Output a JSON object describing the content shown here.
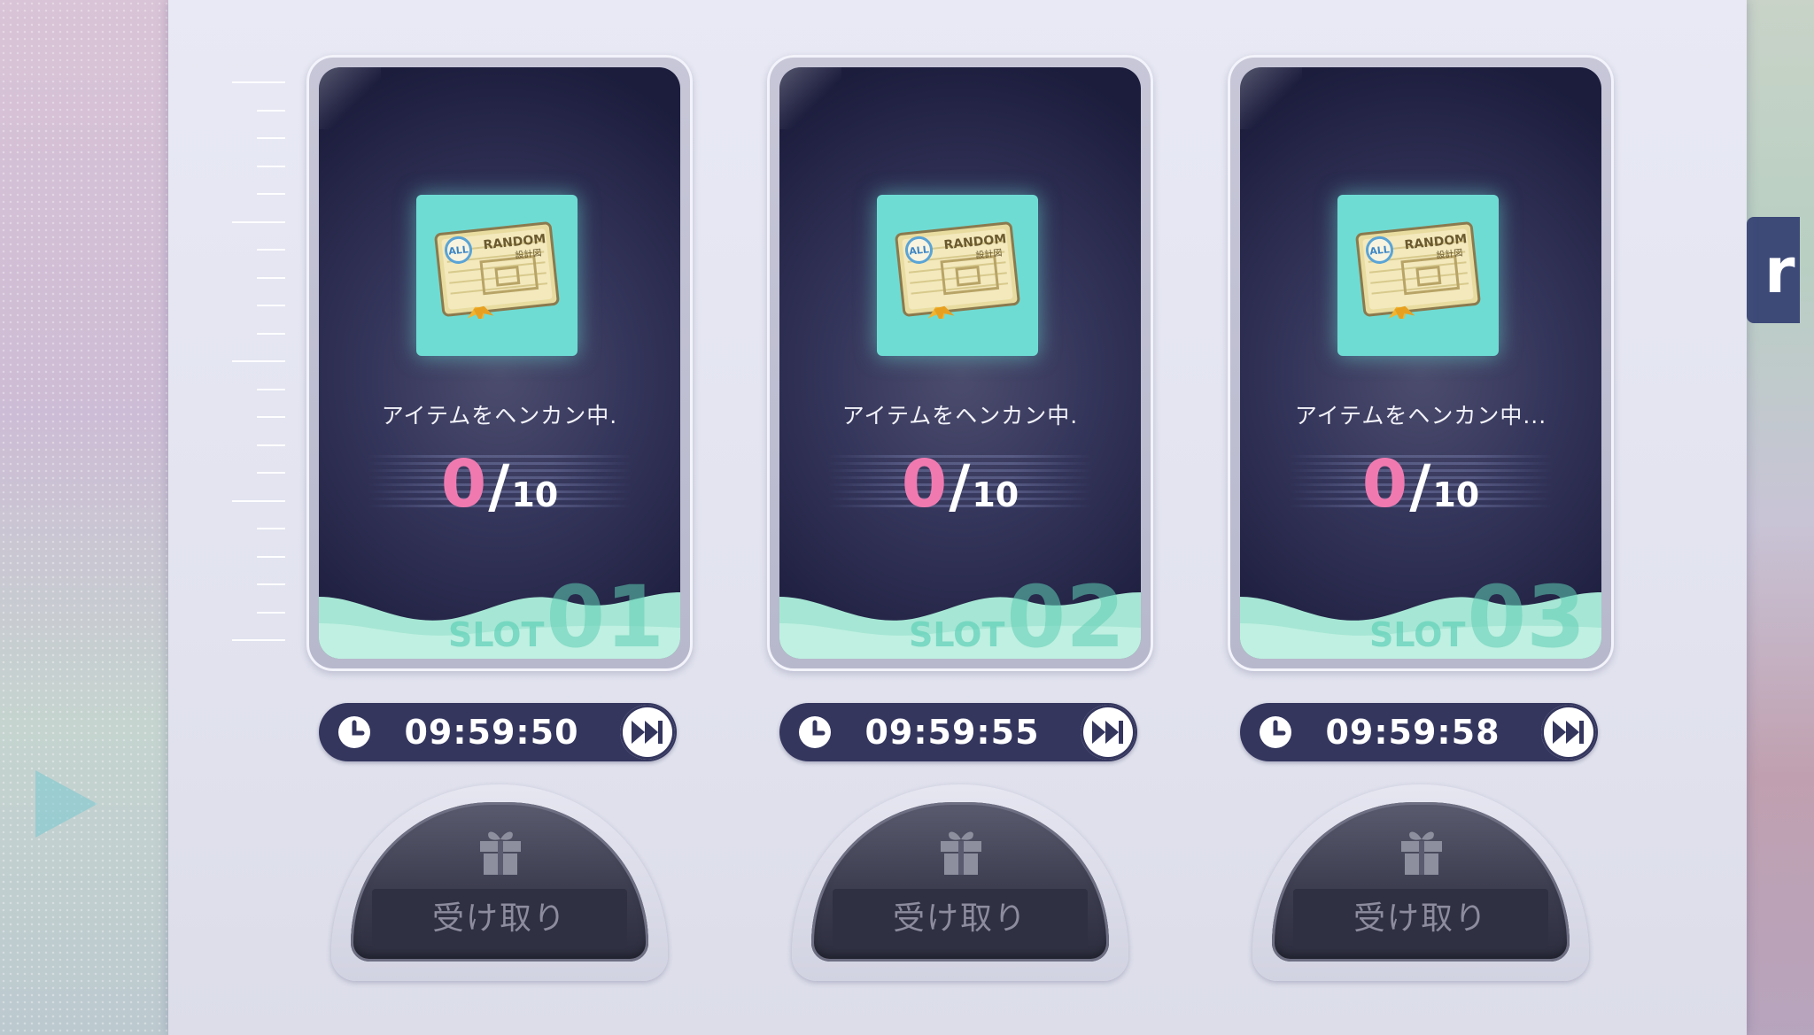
{
  "colors": {
    "accent_pink": "#f07ab0",
    "timer_bg": "#34365e",
    "item_bg": "#6fdcd4",
    "slot_label": "#5fcdb4"
  },
  "side_tab": {
    "text": "r"
  },
  "slots": [
    {
      "status": "アイテムをヘンカン中.",
      "current": "0",
      "slash": "/",
      "max": "10",
      "slot_label": "SLOT",
      "slot_number": "01",
      "timer": "09:59:50",
      "claim_label": "受け取り",
      "item": {
        "badge": "ALL",
        "title": "RANDOM",
        "subtitle": "設計図"
      }
    },
    {
      "status": "アイテムをヘンカン中.",
      "current": "0",
      "slash": "/",
      "max": "10",
      "slot_label": "SLOT",
      "slot_number": "02",
      "timer": "09:59:55",
      "claim_label": "受け取り",
      "item": {
        "badge": "ALL",
        "title": "RANDOM",
        "subtitle": "設計図"
      }
    },
    {
      "status": "アイテムをヘンカン中...",
      "current": "0",
      "slash": "/",
      "max": "10",
      "slot_label": "SLOT",
      "slot_number": "03",
      "timer": "09:59:58",
      "claim_label": "受け取り",
      "item": {
        "badge": "ALL",
        "title": "RANDOM",
        "subtitle": "設計図"
      }
    }
  ],
  "icons": {
    "clock": "clock-icon",
    "skip": "fast-forward-icon",
    "gift": "gift-icon",
    "item": "random-blueprint-icon"
  }
}
